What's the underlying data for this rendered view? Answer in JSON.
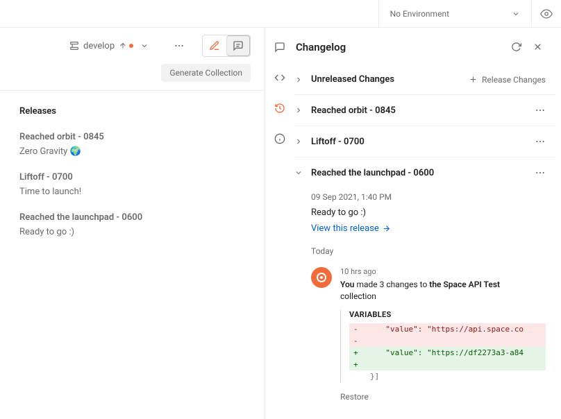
{
  "env": {
    "label": "No Environment"
  },
  "branch": {
    "name": "develop"
  },
  "generateCollection": "Generate Collection",
  "releasesHeading": "Releases",
  "releases": [
    {
      "title": "Reached orbit - 0845",
      "desc": "Zero Gravity 🌍"
    },
    {
      "title": "Liftoff - 0700",
      "desc": "Time to launch!"
    },
    {
      "title": "Reached the launchpad - 0600",
      "desc": "Ready to go :)"
    }
  ],
  "changelog": {
    "title": "Changelog",
    "unreleased": "Unreleased Changes",
    "releaseChanges": "Release Changes",
    "rows": [
      {
        "title": "Reached orbit - 0845"
      },
      {
        "title": "Liftoff - 0700"
      }
    ],
    "expanded": {
      "title": "Reached the launchpad - 0600",
      "timestamp": "09 Sep 2021, 1:40 PM",
      "desc": "Ready to go :)",
      "viewLink": "View this release",
      "today": "Today",
      "activity": {
        "time": "10 hrs ago",
        "who": "You",
        "verb": " made 3 changes to ",
        "target": "the Space API Test",
        "suffix": "collection",
        "diffLabel": "VARIABLES",
        "diff": {
          "del1": "-      \"value\": \"https://api.space.co",
          "del2": "-",
          "add1": "+      \"value\": \"https://df2273a3-a84",
          "add2": "+",
          "tail": "}]"
        },
        "restore": "Restore"
      }
    }
  }
}
